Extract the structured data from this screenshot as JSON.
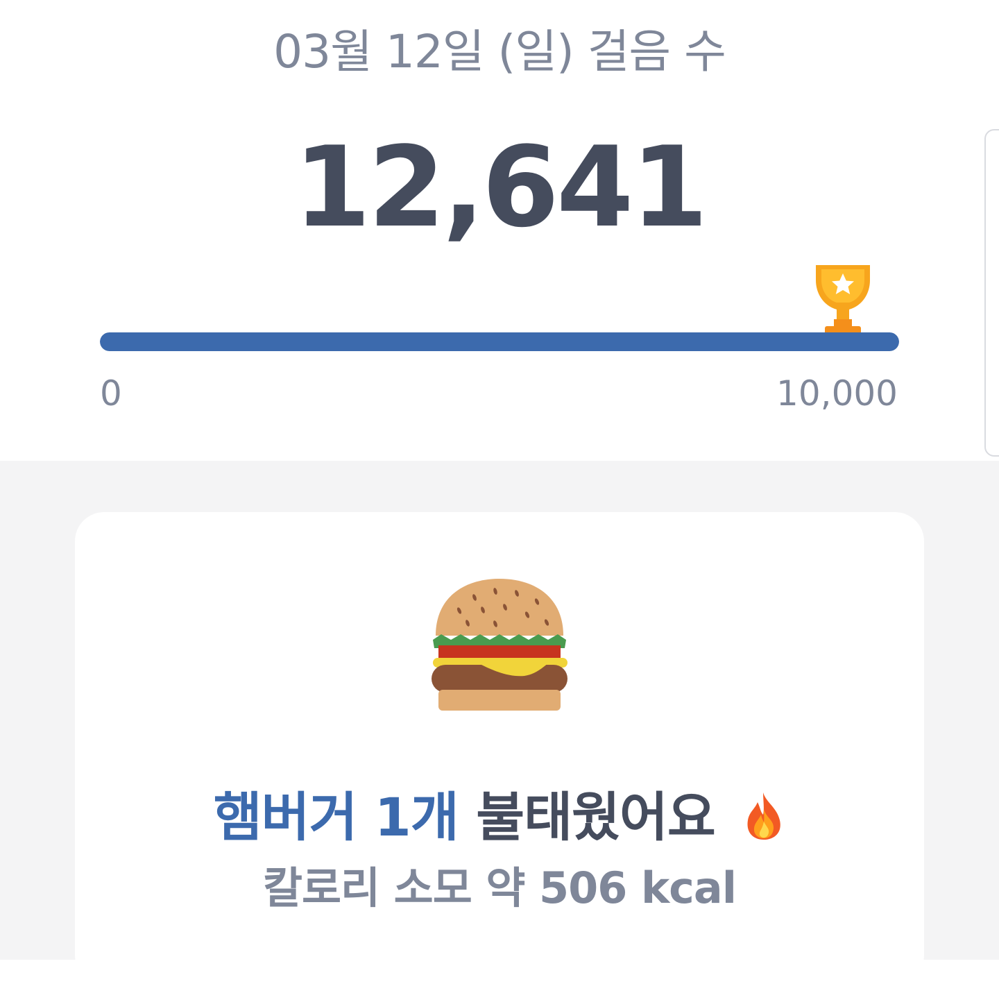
{
  "header": {
    "date_title": "03월 12일 (일) 걸음 수"
  },
  "steps": {
    "count": "12,641",
    "progress_percent": 100,
    "goal_reached": true
  },
  "progress": {
    "min_label": "0",
    "max_label": "10,000"
  },
  "card": {
    "food_label": "햄버거 1개",
    "burn_label": "불태웠어요",
    "calorie_label": "칼로리 소모 약 506 kcal"
  },
  "icons": {
    "trophy": "trophy-icon",
    "burger": "hamburger-icon",
    "flame": "fire-icon"
  },
  "colors": {
    "accent": "#3c6aad",
    "primary_text": "#454c5d",
    "secondary_text": "#7f8799",
    "trophy": "#f7a51d"
  }
}
